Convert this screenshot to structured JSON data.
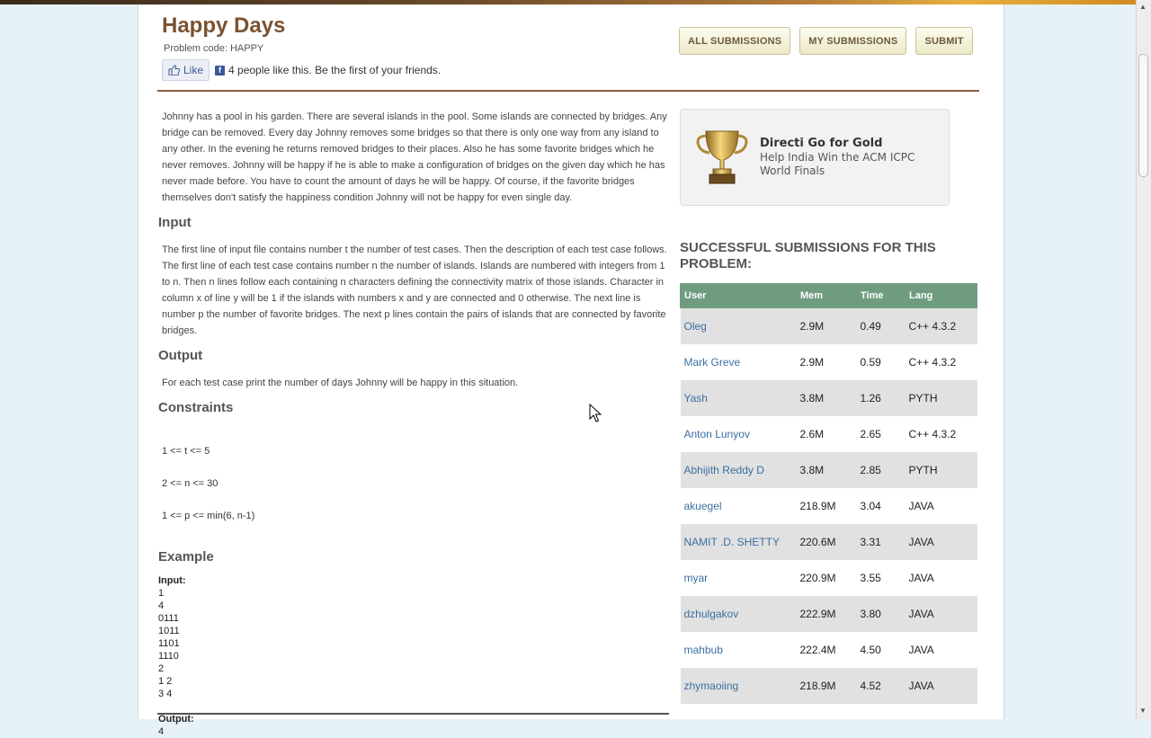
{
  "problem": {
    "title": "Happy Days",
    "code": "Problem code: HAPPY"
  },
  "social": {
    "like_label": "Like",
    "like_text": "4 people like this. Be the first of your friends."
  },
  "buttons": {
    "all": "ALL SUBMISSIONS",
    "mine": "MY SUBMISSIONS",
    "submit": "SUBMIT"
  },
  "statement": {
    "intro": "Johnny has a pool in his garden. There are several islands in the pool. Some islands are connected by bridges. Any bridge can be removed. Every day Johnny removes some bridges so that there is only one way from any island to any other. In the evening he returns removed bridges to their places. Also he has some favorite bridges which he never removes. Johnny will be happy if he is able to make a configuration of bridges on the given day which he has never made before. You have to count the amount of days he will be happy. Of course, if the favorite bridges themselves don't satisfy the happiness condition Johnny will not be happy for even single day.",
    "input_heading": "Input",
    "input_text": "The first line of input file contains number t the number of test cases. Then the description of each test case follows. The first line of each test case contains number n the number of islands. Islands are numbered with integers from 1 to n. Then n lines follow each containing n characters defining the connectivity matrix of those islands. Character in column x of line y will be 1 if the islands with numbers x and y are connected and 0 otherwise. The next line is number p the number of favorite bridges. The next p lines contain the pairs of islands that are connected by favorite bridges.",
    "output_heading": "Output",
    "output_text": "For each test case print the number of days Johnny will be happy in this situation.",
    "constraints_heading": "Constraints",
    "constraints": [
      "1 <= t <= 5",
      "2 <= n <= 30",
      "1 <= p <= min(6, n-1)"
    ],
    "example_heading": "Example",
    "example_input_label": "Input:",
    "example_input": [
      "1",
      "4",
      "0111",
      "1011",
      "1101",
      "1110",
      "2",
      "1 2",
      "3 4"
    ],
    "example_output_label": "Output:",
    "example_output": [
      "4"
    ]
  },
  "promo": {
    "title": "Directi Go for Gold",
    "subtitle": "Help India Win the ACM ICPC World Finals"
  },
  "submissions": {
    "heading": "SUCCESSFUL SUBMISSIONS FOR THIS PROBLEM:",
    "columns": [
      "User",
      "Mem",
      "Time",
      "Lang"
    ],
    "rows": [
      [
        "Oleg",
        "2.9M",
        "0.49",
        "C++ 4.3.2"
      ],
      [
        "Mark Greve",
        "2.9M",
        "0.59",
        "C++ 4.3.2"
      ],
      [
        "Yash",
        "3.8M",
        "1.26",
        "PYTH"
      ],
      [
        "Anton Lunyov",
        "2.6M",
        "2.65",
        "C++ 4.3.2"
      ],
      [
        "Abhijith Reddy D",
        "3.8M",
        "2.85",
        "PYTH"
      ],
      [
        "akuegel",
        "218.9M",
        "3.04",
        "JAVA"
      ],
      [
        "NAMIT .D. SHETTY",
        "220.6M",
        "3.31",
        "JAVA"
      ],
      [
        "myar",
        "220.9M",
        "3.55",
        "JAVA"
      ],
      [
        "dzhulgakov",
        "222.9M",
        "3.80",
        "JAVA"
      ],
      [
        "mahbub",
        "222.4M",
        "4.50",
        "JAVA"
      ],
      [
        "zhymaoiing",
        "218.9M",
        "4.52",
        "JAVA"
      ]
    ]
  },
  "colors": {
    "title": "#7a5232",
    "table_header": "#6f9c7f",
    "link": "#3b6fa0"
  }
}
